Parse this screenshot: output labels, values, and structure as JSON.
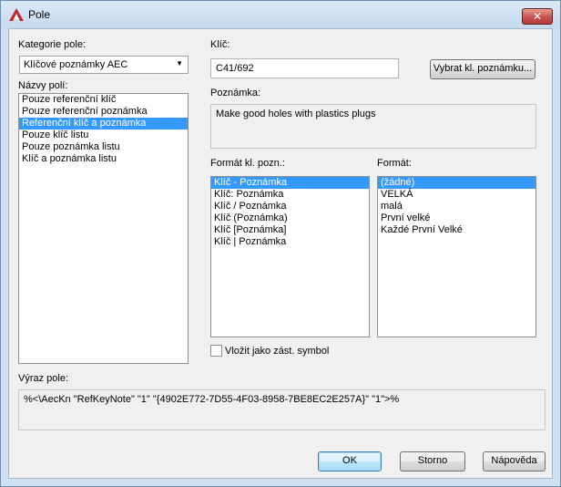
{
  "window": {
    "title": "Pole",
    "close_glyph": "✕",
    "app_icon": "autocad-a-icon",
    "accent": "#c0272d"
  },
  "kategorie": {
    "label": "Kategorie pole:",
    "selected": "Klíčové poznámky AEC"
  },
  "nazvy": {
    "label": "Názvy polí:",
    "items": [
      "Pouze referenční klíč",
      "Pouze referenční poznámka",
      "Referenční klíč a poznámka",
      "Pouze klíč listu",
      "Pouze poznámka listu",
      "Klíč a poznámka listu"
    ],
    "selected": "Referenční klíč a poznámka"
  },
  "klic": {
    "label": "Klíč:",
    "value": "C41/692",
    "button": "Vybrat kl. poznámku..."
  },
  "poznamka": {
    "label": "Poznámka:",
    "value": "Make good holes with plastics plugs"
  },
  "format_kl": {
    "label": "Formát kl. pozn.:",
    "items": [
      "Klíč - Poznámka",
      "Klíč: Poznámka",
      "Klíč / Poznámka",
      "Klíč (Poznámka)",
      "Klíč [Poznámka]",
      "Klíč | Poznámka"
    ],
    "selected": "Klíč - Poznámka"
  },
  "format": {
    "label": "Formát:",
    "items": [
      "(žádné)",
      "VELKÁ",
      "malá",
      "První velké",
      "Každé První Velké"
    ],
    "selected": "(žádné)"
  },
  "vlozit": {
    "label": "Vložit jako zást. symbol",
    "checked": false
  },
  "vyraz": {
    "label": "Výraz pole:",
    "value": "%<\\AecKn \"RefKeyNote\" \"1\" \"{4902E772-7D55-4F03-8958-7BE8EC2E257A}\" \"1\">%"
  },
  "buttons": {
    "ok": "OK",
    "storno": "Storno",
    "napoveda": "Nápověda"
  }
}
